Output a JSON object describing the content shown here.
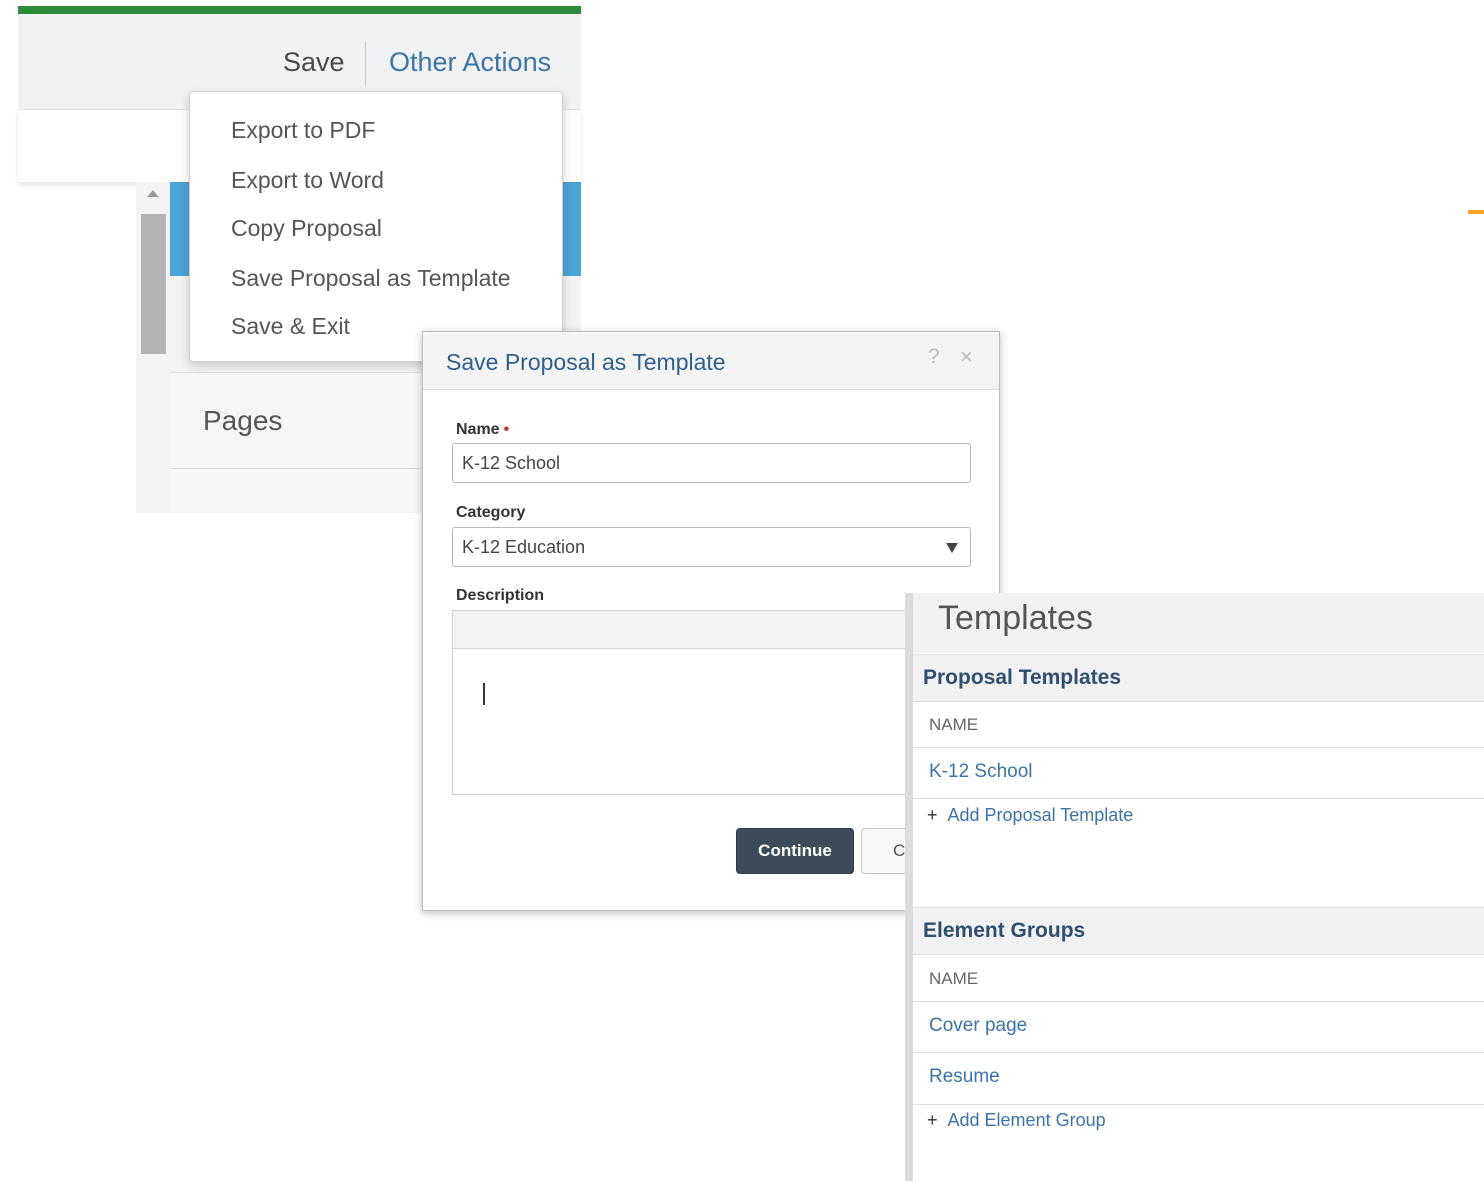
{
  "toolbar": {
    "save_label": "Save",
    "other_actions_label": "Other Actions"
  },
  "other_actions_menu": {
    "items": [
      {
        "label": "Export to PDF"
      },
      {
        "label": "Export to Word"
      },
      {
        "label": "Copy Proposal"
      },
      {
        "label": "Save Proposal as Template"
      },
      {
        "label": "Save & Exit"
      }
    ]
  },
  "sidebar": {
    "pages_label": "Pages"
  },
  "dialog": {
    "title": "Save Proposal as Template",
    "help_icon": "?",
    "close_icon": "×",
    "name_label": "Name",
    "required_marker": "•",
    "name_value": "K-12 School",
    "category_label": "Category",
    "category_value": "K-12 Education",
    "description_label": "Description",
    "description_value": "",
    "continue_label": "Continue",
    "cancel_label": "C"
  },
  "templates_panel": {
    "title": "Templates",
    "proposal_templates": {
      "header": "Proposal Templates",
      "column": "NAME",
      "rows": [
        {
          "name": "K-12 School"
        }
      ],
      "add_label": "Add Proposal Template"
    },
    "element_groups": {
      "header": "Element Groups",
      "column": "NAME",
      "rows": [
        {
          "name": "Cover page"
        },
        {
          "name": "Resume"
        }
      ],
      "add_label": "Add Element Group"
    },
    "add_icon": "+"
  },
  "colors": {
    "accent_green": "#2e8b3a",
    "link_blue": "#3c74a8",
    "band_blue": "#4ba3d6",
    "button_dark": "#3d4b5a",
    "orange": "#f5a623"
  }
}
